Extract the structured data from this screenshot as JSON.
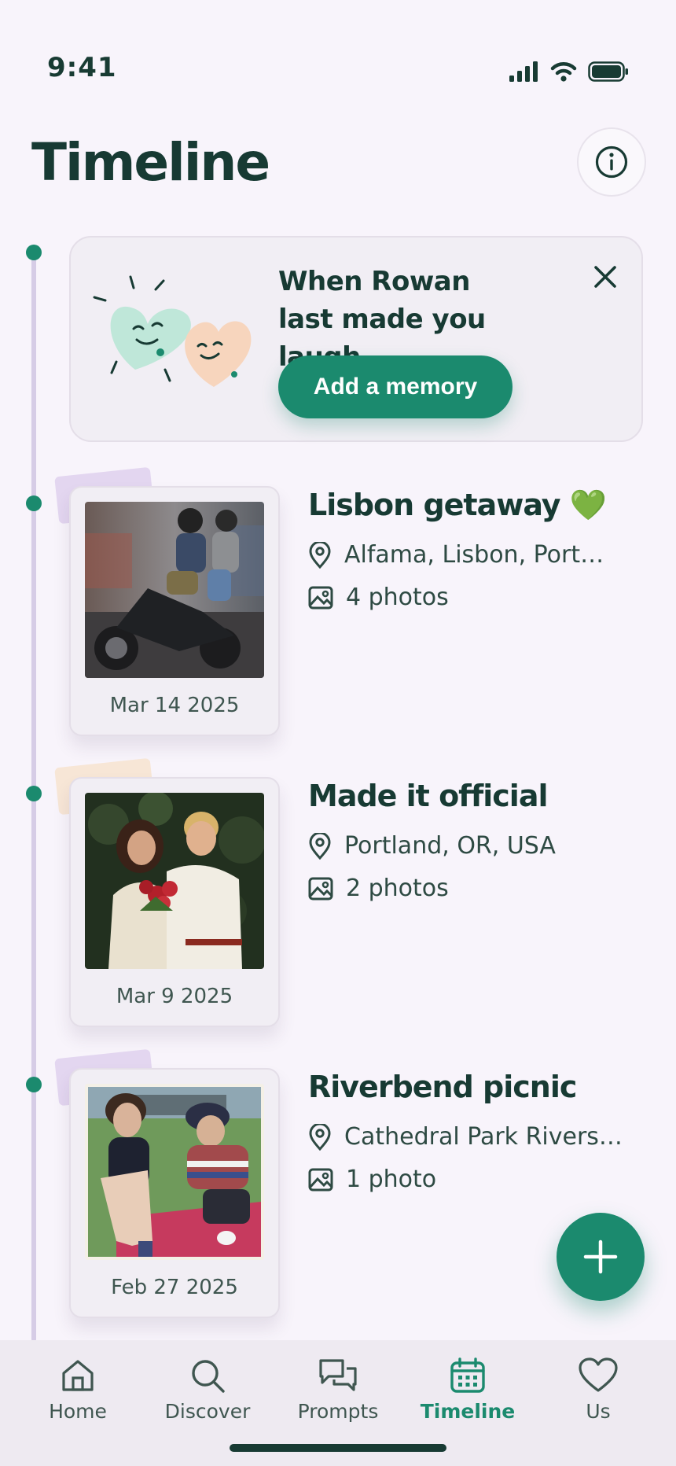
{
  "status_bar": {
    "time": "9:41"
  },
  "header": {
    "title": "Timeline"
  },
  "prompt_card": {
    "title": "When Rowan last made you laugh",
    "button_label": "Add a memory"
  },
  "memories": [
    {
      "title": "Lisbon getaway 💚",
      "location": "Alfama, Lisbon, Port…",
      "photos": "4 photos",
      "date": "Mar 14 2025"
    },
    {
      "title": "Made it official",
      "location": "Portland, OR, USA",
      "photos": "2 photos",
      "date": "Mar 9 2025"
    },
    {
      "title": "Riverbend picnic",
      "location": "Cathedral Park Rivers…",
      "photos": "1 photo",
      "date": "Feb 27 2025"
    }
  ],
  "nav": {
    "items": [
      {
        "label": "Home",
        "icon": "home-icon"
      },
      {
        "label": "Discover",
        "icon": "search-icon"
      },
      {
        "label": "Prompts",
        "icon": "chat-bubbles-icon"
      },
      {
        "label": "Timeline",
        "icon": "calendar-icon"
      },
      {
        "label": "Us",
        "icon": "heart-icon"
      }
    ],
    "active": "Timeline"
  },
  "colors": {
    "accent": "#1b8a6e",
    "text": "#173a33",
    "background": "#f8f4fb"
  }
}
